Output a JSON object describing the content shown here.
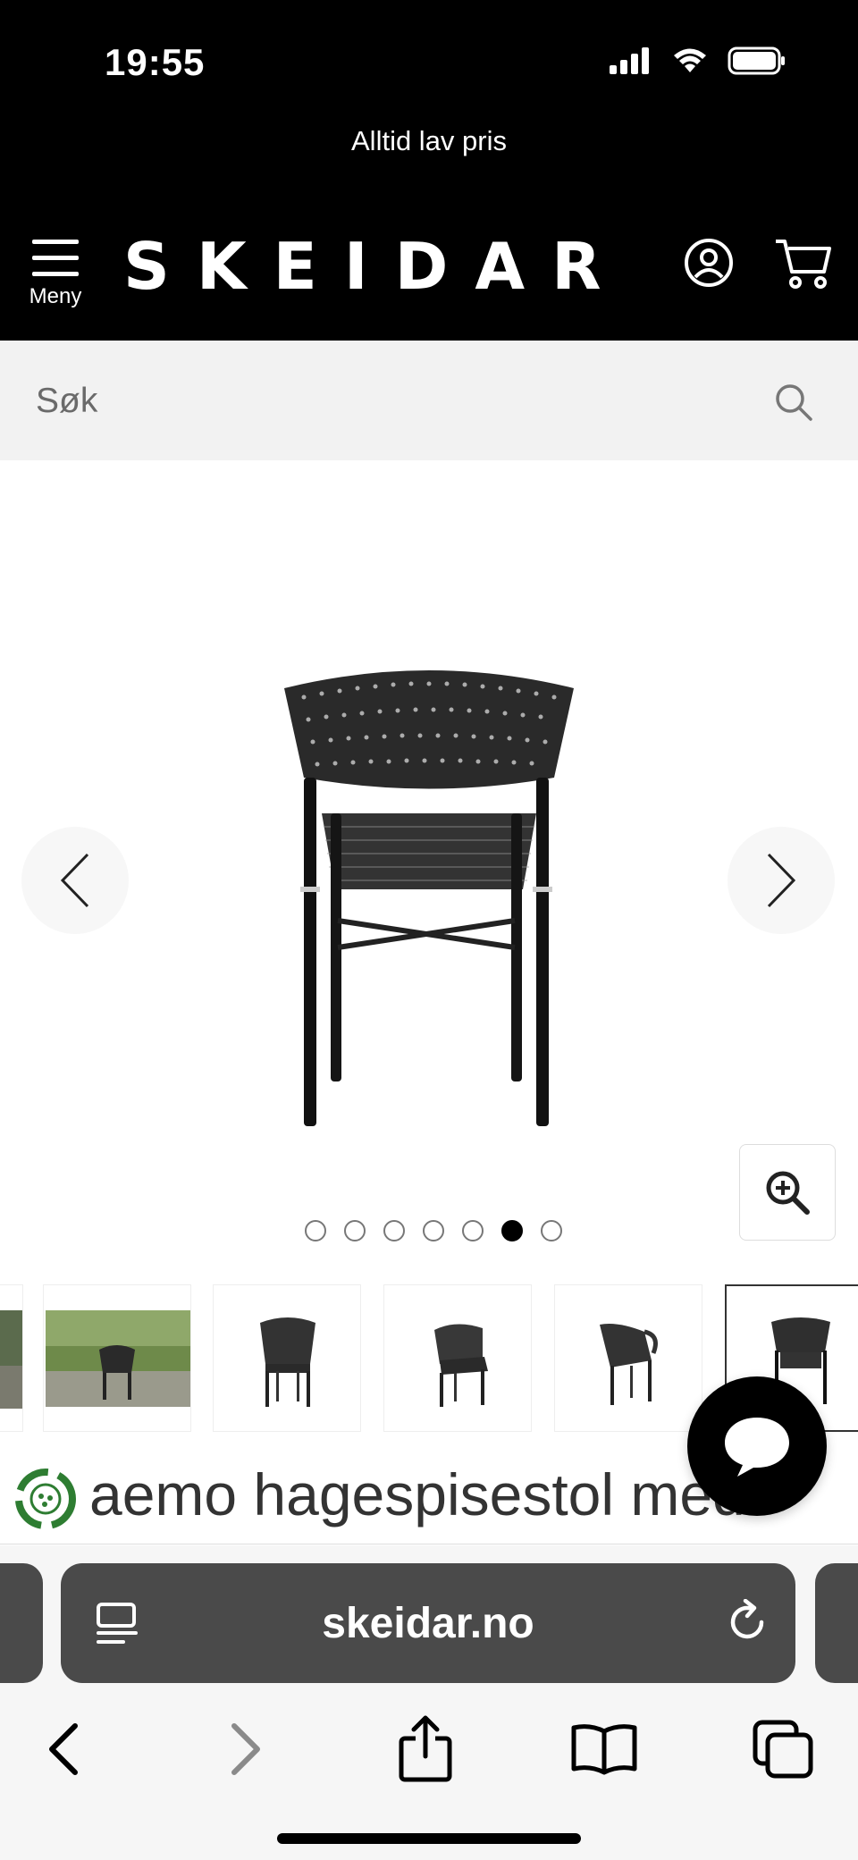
{
  "status_bar": {
    "time": "19:55"
  },
  "promo": {
    "text": "Alltid lav pris"
  },
  "header": {
    "menu_label": "Meny",
    "logo": "SKEIDAR"
  },
  "search": {
    "placeholder": "Søk"
  },
  "gallery": {
    "image_count": 7,
    "active_index": 5,
    "thumbnails": [
      "lifestyle-edge",
      "lifestyle-garden",
      "chair-front",
      "chair-angle-left",
      "chair-side",
      "chair-back"
    ]
  },
  "product": {
    "title": "aemo hagespisestol med"
  },
  "browser": {
    "url": "skeidar.no"
  },
  "colors": {
    "header_bg": "#000000",
    "search_bg": "#f2f2f2",
    "browser_bar": "#4a4a4a",
    "eco_green": "#2e7d32"
  }
}
